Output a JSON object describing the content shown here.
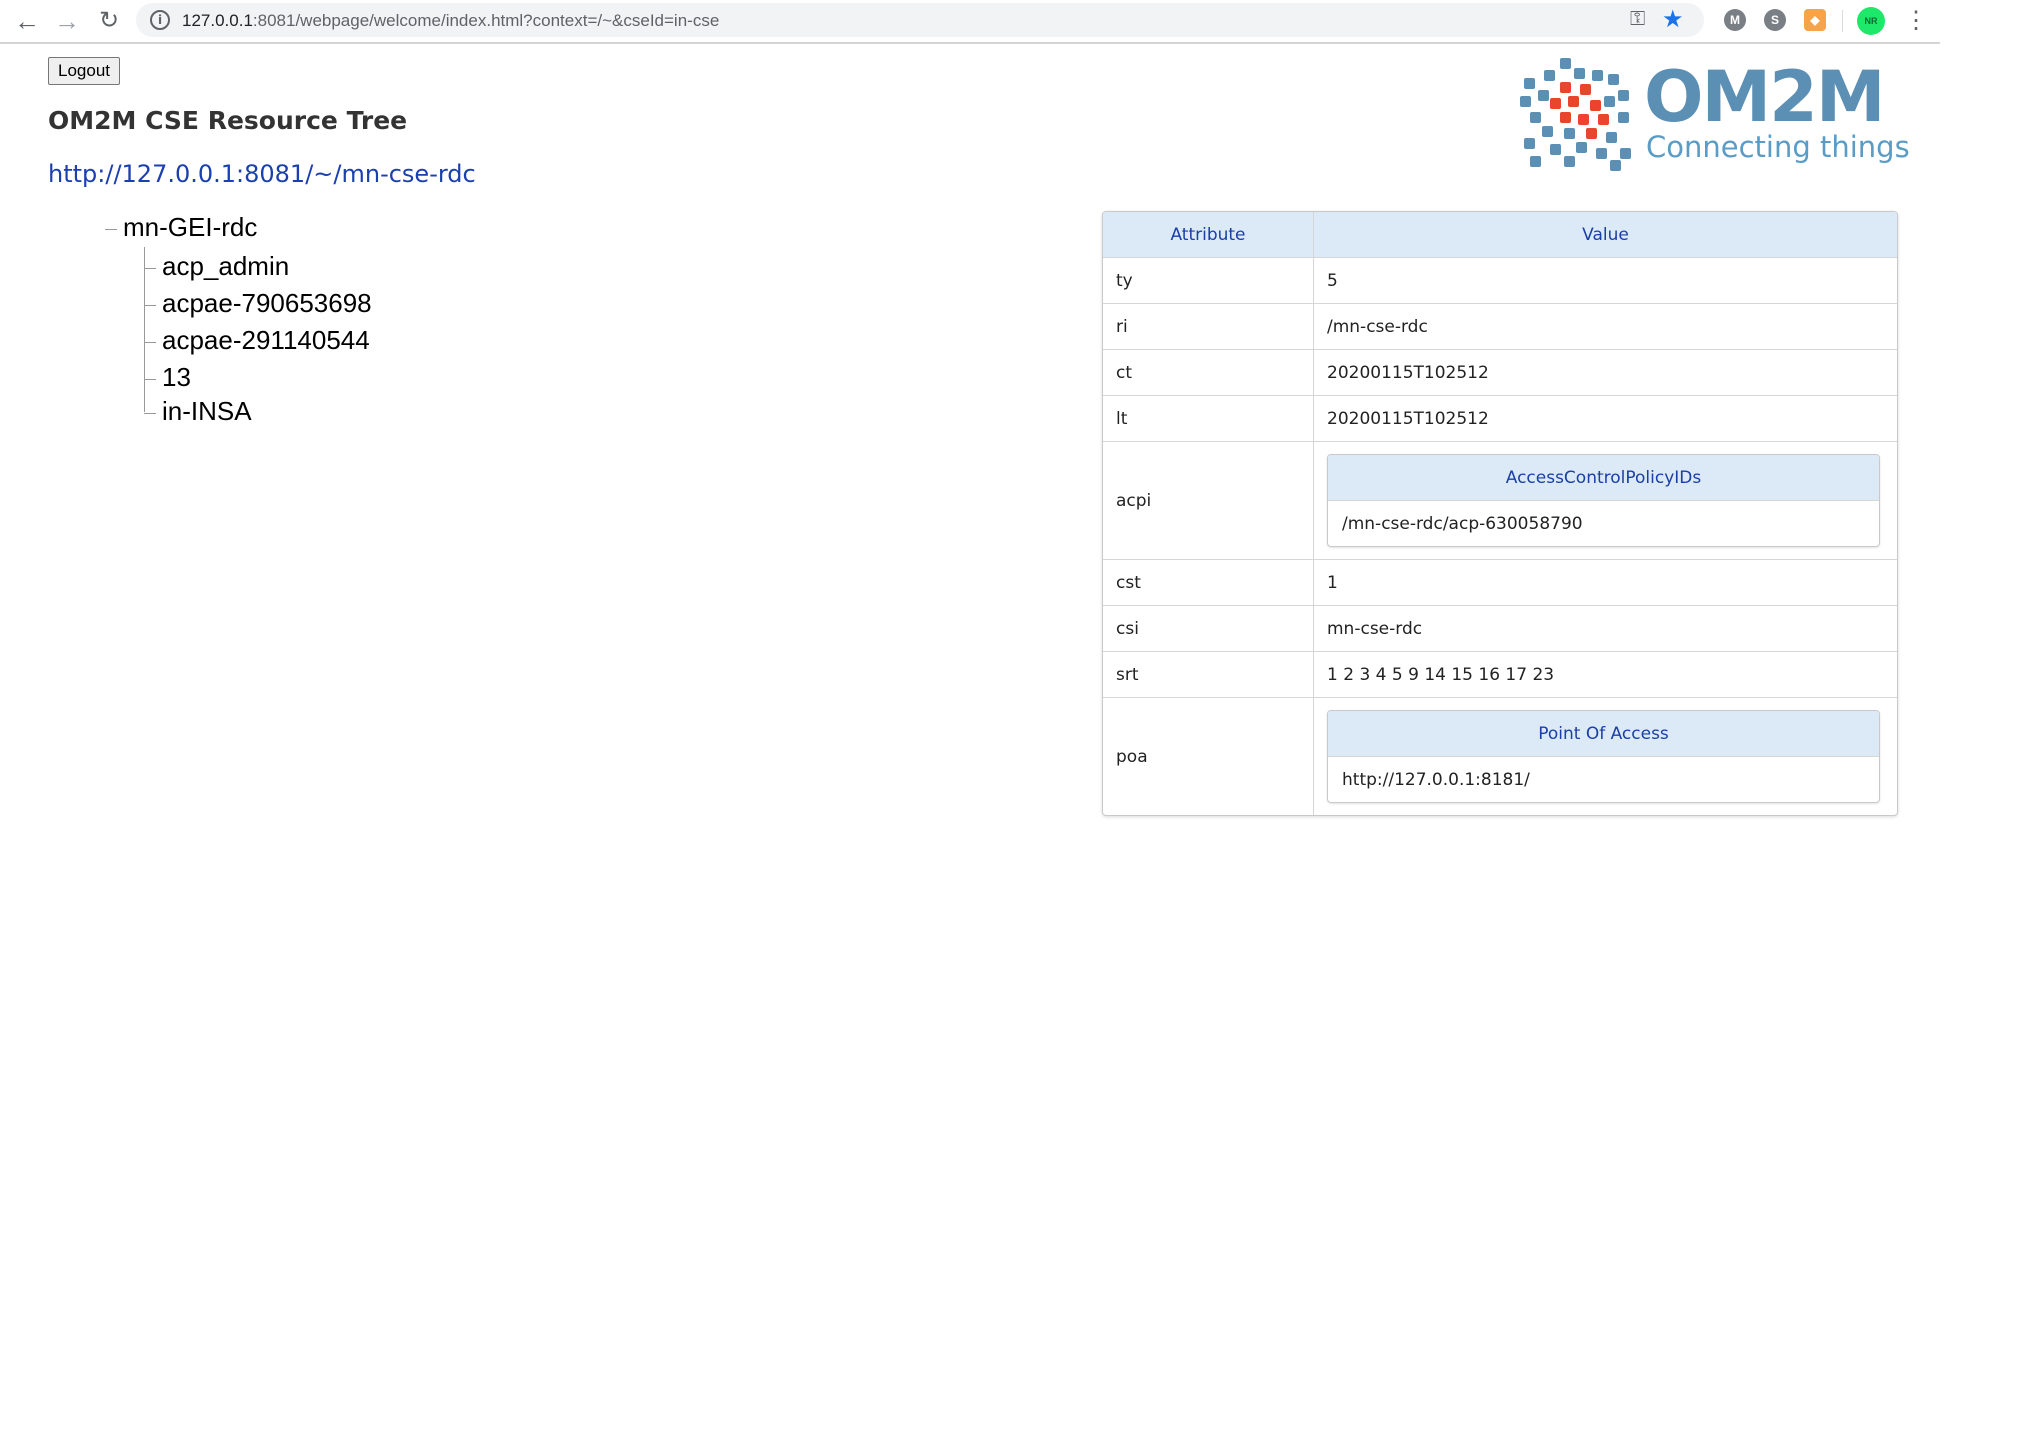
{
  "browser": {
    "url_host": "127.0.0.1",
    "url_rest": ":8081/webpage/welcome/index.html?context=/~&cseId=in-cse",
    "avatar_initials": "NR"
  },
  "page": {
    "logout_label": "Logout",
    "title": "OM2M CSE Resource Tree",
    "cse_link": "http://127.0.0.1:8081/~/mn-cse-rdc"
  },
  "logo": {
    "name": "OM2M",
    "tagline": "Connecting things"
  },
  "tree": {
    "root": "mn-GEI-rdc",
    "children": [
      "acp_admin",
      "acpae-790653698",
      "acpae-291140544",
      "13",
      "in-INSA"
    ]
  },
  "table": {
    "headers": {
      "attribute": "Attribute",
      "value": "Value"
    },
    "rows": [
      {
        "attr": "ty",
        "value": "5"
      },
      {
        "attr": "ri",
        "value": "/mn-cse-rdc"
      },
      {
        "attr": "ct",
        "value": "20200115T102512"
      },
      {
        "attr": "lt",
        "value": "20200115T102512"
      },
      {
        "attr": "acpi",
        "sub_header": "AccessControlPolicyIDs",
        "sub_value": "/mn-cse-rdc/acp-630058790"
      },
      {
        "attr": "cst",
        "value": "1"
      },
      {
        "attr": "csi",
        "value": "mn-cse-rdc"
      },
      {
        "attr": "srt",
        "value": "1 2 3 4 5 9 14 15 16 17 23"
      },
      {
        "attr": "poa",
        "sub_header": "Point Of Access",
        "sub_value": "http://127.0.0.1:8181/"
      }
    ]
  },
  "colors": {
    "accent_blue": "#1a3fa5",
    "header_bg": "#dce9f7",
    "logo_blue": "#5b8fb4",
    "logo_red": "#e8452c"
  }
}
